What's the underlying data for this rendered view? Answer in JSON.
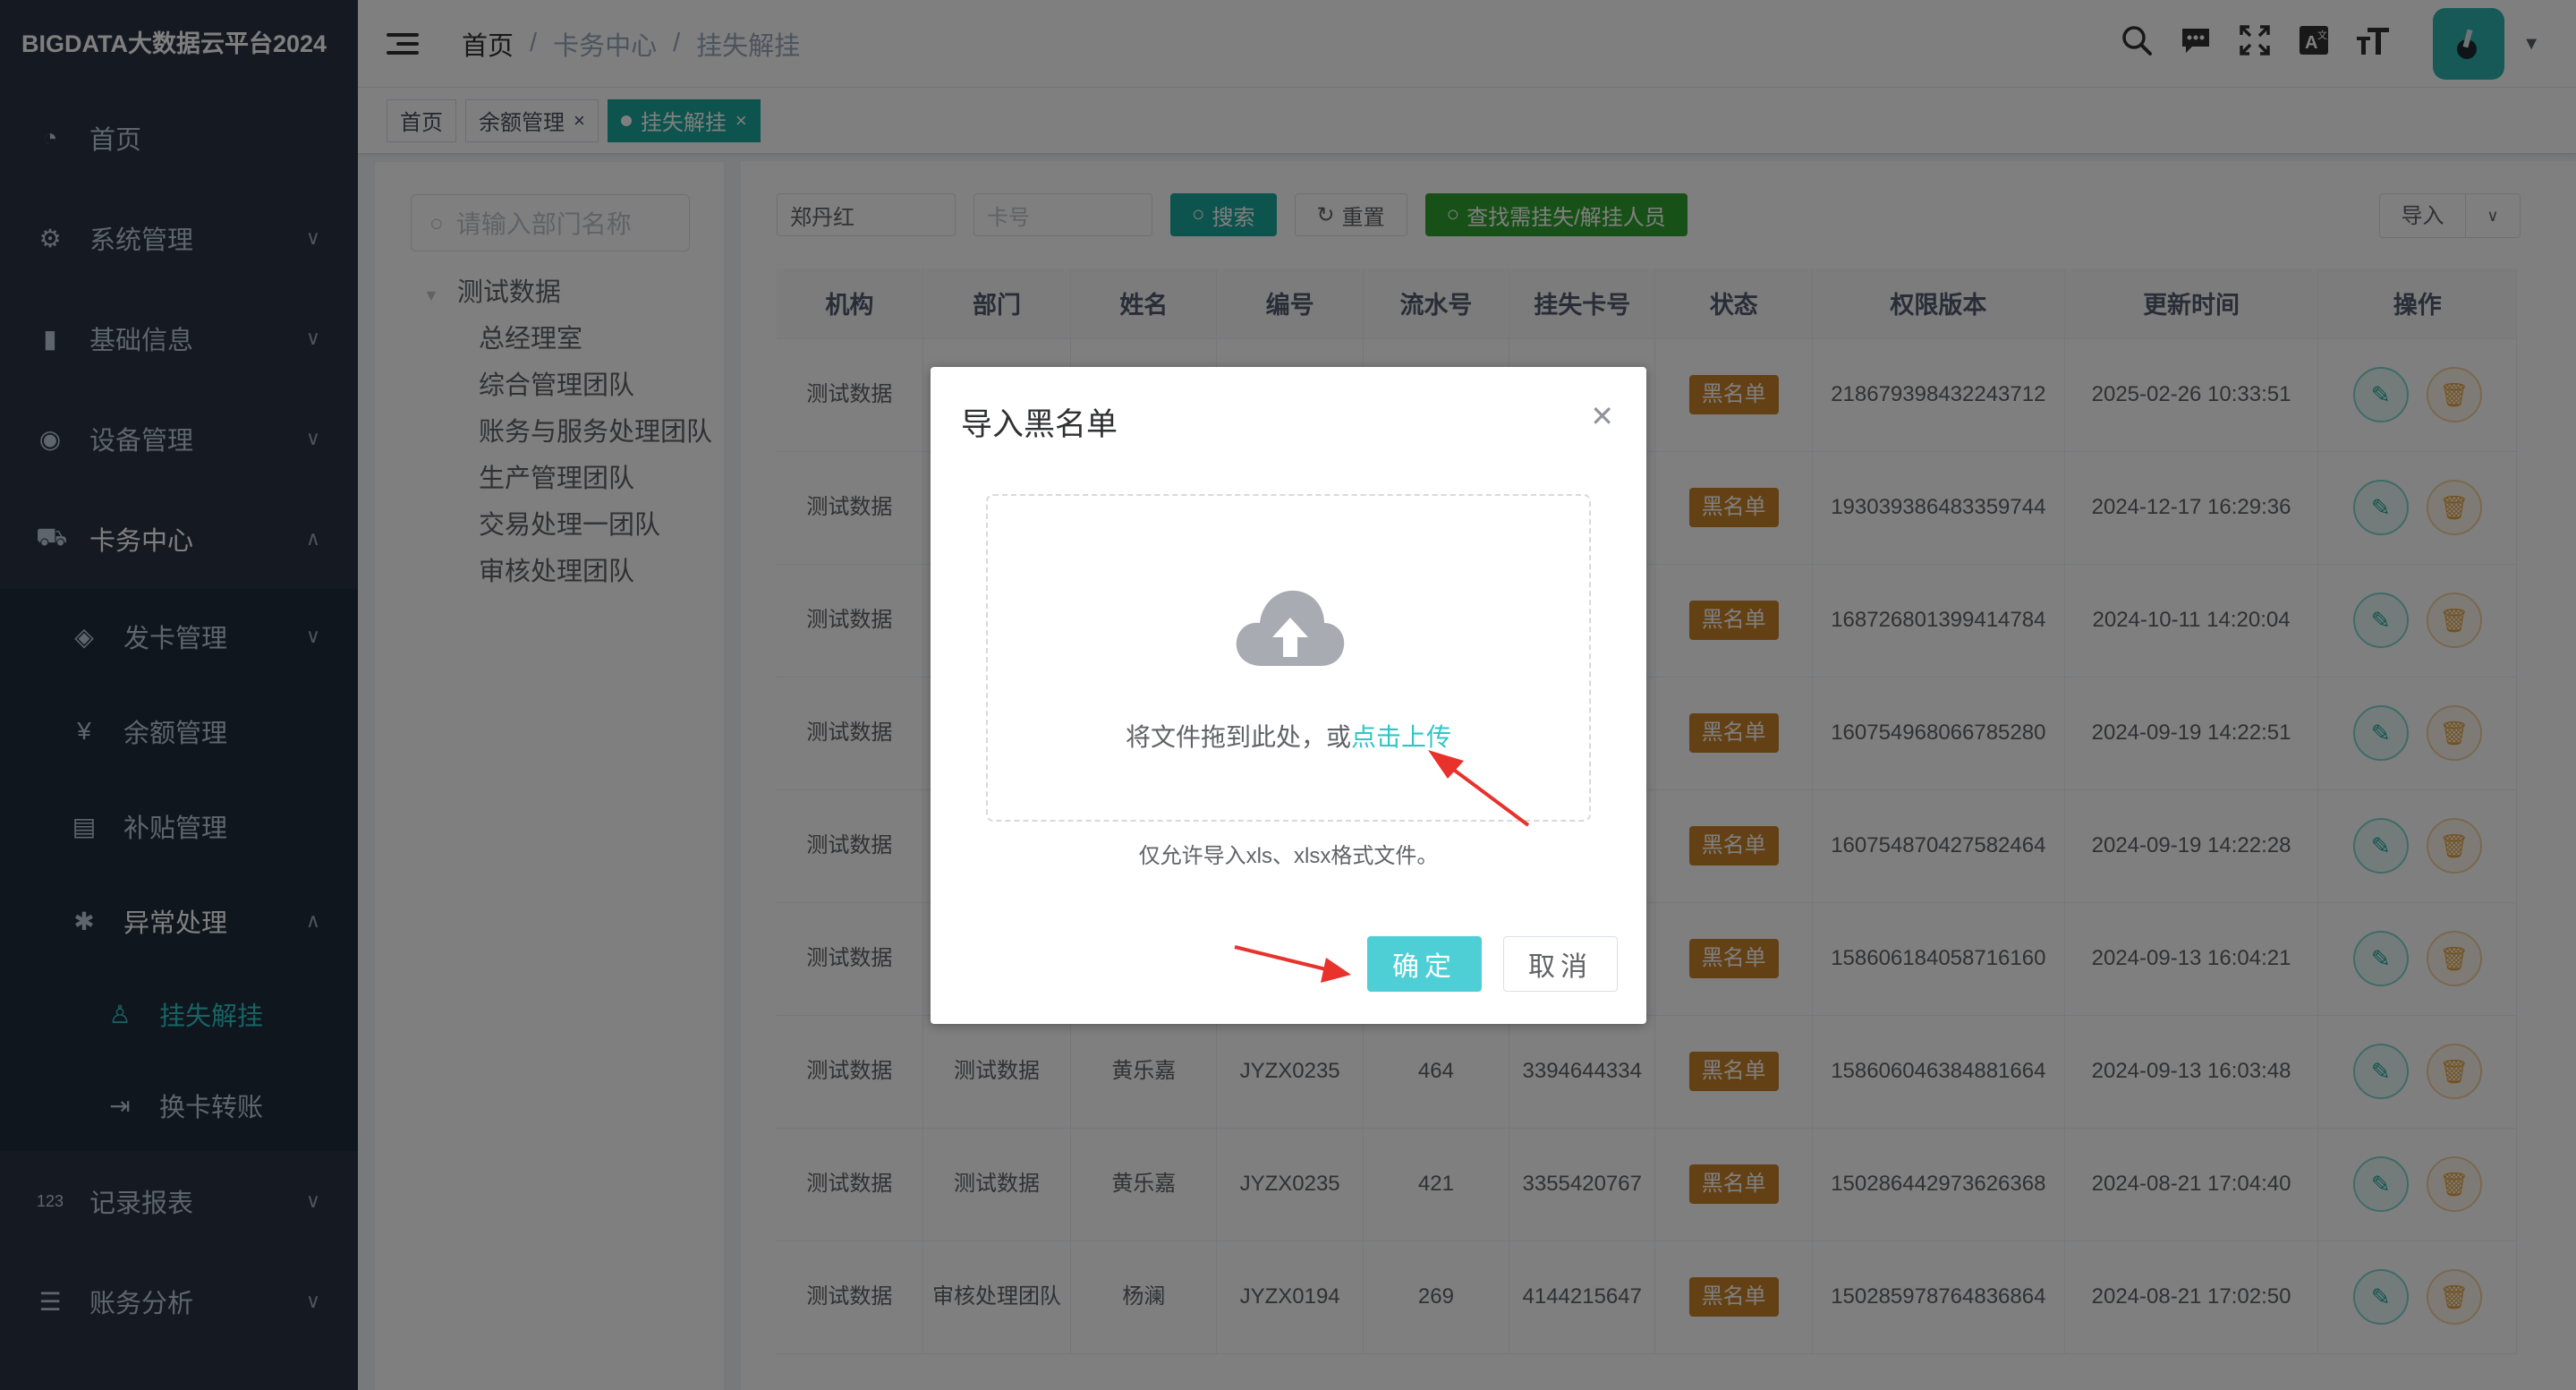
{
  "app": {
    "title": "BIGDATA大数据云平台2024"
  },
  "sidebar": {
    "items": [
      {
        "label": "首页",
        "icon": "dashboard-icon"
      },
      {
        "label": "系统管理",
        "icon": "gear-icon"
      },
      {
        "label": "基础信息",
        "icon": "bar-chart-icon"
      },
      {
        "label": "设备管理",
        "icon": "target-icon"
      },
      {
        "label": "卡务中心",
        "icon": "cart-icon"
      },
      {
        "label": "发卡管理",
        "icon": "card-icon"
      },
      {
        "label": "余额管理",
        "icon": "yen-icon"
      },
      {
        "label": "补贴管理",
        "icon": "document-icon"
      },
      {
        "label": "异常处理",
        "icon": "bug-icon"
      },
      {
        "label": "挂失解挂",
        "icon": "user-icon"
      },
      {
        "label": "换卡转账",
        "icon": "transfer-icon"
      },
      {
        "label": "记录报表",
        "icon": "number-icon"
      },
      {
        "label": "账务分析",
        "icon": "list-icon"
      }
    ]
  },
  "header": {
    "breadcrumb": [
      "首页",
      "卡务中心",
      "挂失解挂"
    ],
    "icons": [
      "search-icon",
      "message-icon",
      "fullscreen-icon",
      "translate-icon",
      "font-size-icon"
    ]
  },
  "tags": [
    {
      "label": "首页"
    },
    {
      "label": "余额管理"
    },
    {
      "label": "挂失解挂"
    }
  ],
  "dept": {
    "placeholder": "请输入部门名称",
    "root": "测试数据",
    "children": [
      "总经理室",
      "综合管理团队",
      "账务与服务处理团队",
      "生产管理团队",
      "交易处理一团队",
      "审核处理团队"
    ]
  },
  "search": {
    "name_value": "郑丹红",
    "card_placeholder": "卡号",
    "search_label": "搜索",
    "reset_label": "重置",
    "find_label": "查找需挂失/解挂人员",
    "import_label": "导入"
  },
  "table": {
    "headers": [
      "机构",
      "部门",
      "姓名",
      "编号",
      "流水号",
      "挂失卡号",
      "状态",
      "权限版本",
      "更新时间",
      "操作"
    ],
    "rows": [
      {
        "org": "测试数据",
        "dept": "",
        "name": "",
        "code": "",
        "serial": "",
        "card": "",
        "status": "黑名单",
        "version": "218679398432243712",
        "time": "2025-02-26 10:33:51"
      },
      {
        "org": "测试数据",
        "dept": "",
        "name": "",
        "code": "",
        "serial": "",
        "card": "",
        "status": "黑名单",
        "version": "193039386483359744",
        "time": "2024-12-17 16:29:36"
      },
      {
        "org": "测试数据",
        "dept": "",
        "name": "",
        "code": "",
        "serial": "",
        "card": "",
        "status": "黑名单",
        "version": "168726801399414784",
        "time": "2024-10-11 14:20:04"
      },
      {
        "org": "测试数据",
        "dept": "",
        "name": "",
        "code": "",
        "serial": "",
        "card": "",
        "status": "黑名单",
        "version": "160754968066785280",
        "time": "2024-09-19 14:22:51"
      },
      {
        "org": "测试数据",
        "dept": "",
        "name": "",
        "code": "",
        "serial": "",
        "card": "",
        "status": "黑名单",
        "version": "160754870427582464",
        "time": "2024-09-19 14:22:28"
      },
      {
        "org": "测试数据",
        "dept": "",
        "name": "",
        "code": "",
        "serial": "",
        "card": "",
        "status": "黑名单",
        "version": "158606184058716160",
        "time": "2024-09-13 16:04:21"
      },
      {
        "org": "测试数据",
        "dept": "测试数据",
        "name": "黄乐嘉",
        "code": "JYZX0235",
        "serial": "464",
        "card": "3394644334",
        "status": "黑名单",
        "version": "158606046384881664",
        "time": "2024-09-13 16:03:48"
      },
      {
        "org": "测试数据",
        "dept": "测试数据",
        "name": "黄乐嘉",
        "code": "JYZX0235",
        "serial": "421",
        "card": "3355420767",
        "status": "黑名单",
        "version": "150286442973626368",
        "time": "2024-08-21 17:04:40"
      },
      {
        "org": "测试数据",
        "dept": "审核处理团队",
        "name": "杨澜",
        "code": "JYZX0194",
        "serial": "269",
        "card": "4144215647",
        "status": "黑名单",
        "version": "150285978764836864",
        "time": "2024-08-21 17:02:50"
      }
    ]
  },
  "dialog": {
    "title": "导入黑名单",
    "drag_text": "将文件拖到此处，或",
    "click_text": "点击上传",
    "tip": "仅允许导入xls、xlsx格式文件。",
    "ok_label": "确定",
    "cancel_label": "取消"
  },
  "colors": {
    "accent": "#1aa79c",
    "sidebar": "#2b3545",
    "badge": "#c8832b",
    "link": "#2fc6c6",
    "arrow": "#e8322b"
  }
}
